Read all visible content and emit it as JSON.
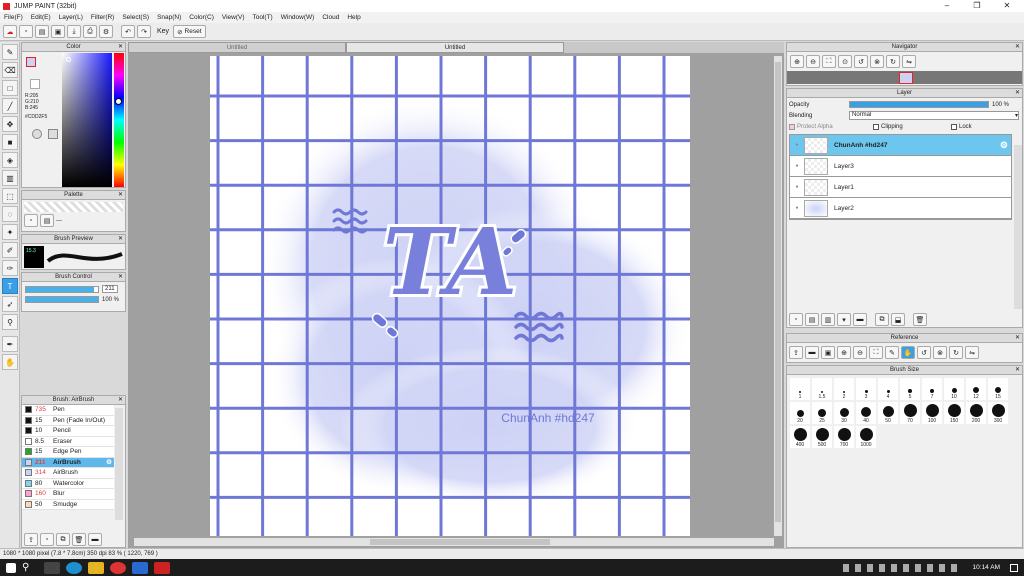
{
  "window": {
    "title": "JUMP PAINT (32bit)"
  },
  "menu": [
    "File(F)",
    "Edit(E)",
    "Layer(L)",
    "Filter(R)",
    "Select(S)",
    "Snap(N)",
    "Color(C)",
    "View(V)",
    "Tool(T)",
    "Window(W)",
    "Cloud",
    "Help"
  ],
  "toolbar": {
    "key_label": "Key",
    "reset_label": "Reset"
  },
  "color_panel": {
    "title": "Color",
    "r": "R:205",
    "g": "G:210",
    "b": "B:245",
    "hex": "#CDD2F5"
  },
  "palette_panel": {
    "title": "Palette",
    "dash": "---"
  },
  "brush_preview": {
    "title": "Brush Preview",
    "size": "15.3"
  },
  "brush_control": {
    "title": "Brush Control",
    "size": "211",
    "opacity": "100 %",
    "size_fill": 0.95,
    "opacity_fill": 1.0
  },
  "brush_list": {
    "title": "Brush: AirBrush",
    "items": [
      {
        "size": "735",
        "name": "Pen",
        "color": "#111111",
        "red": true
      },
      {
        "size": "15",
        "name": "Pen (Fade In/Out)",
        "color": "#111111",
        "red": false
      },
      {
        "size": "10",
        "name": "Pencil",
        "color": "#111111",
        "red": false
      },
      {
        "size": "8.5",
        "name": "Eraser",
        "color": "#ffffff",
        "red": false
      },
      {
        "size": "15",
        "name": "Edge Pen",
        "color": "#22aa22",
        "red": false
      },
      {
        "size": "211",
        "name": "AirBrush",
        "color": "#cdd2f5",
        "red": true,
        "selected": true
      },
      {
        "size": "314",
        "name": "AirBrush",
        "color": "#cdd2f5",
        "red": true
      },
      {
        "size": "80",
        "name": "Watercolor",
        "color": "#7fd6f0",
        "red": false
      },
      {
        "size": "160",
        "name": "Blur",
        "color": "#ff9fd0",
        "red": true
      },
      {
        "size": "50",
        "name": "Smudge",
        "color": "#ffd8b8",
        "red": false
      }
    ]
  },
  "tabs": [
    "Untitled",
    "Untitled"
  ],
  "canvas": {
    "watermark": "ChunAnh #hd247",
    "logo_text": "TA",
    "accent": "#6f78d6"
  },
  "navigator": {
    "title": "Navigator"
  },
  "layer_panel": {
    "title": "Layer",
    "opacity_label": "Opacity",
    "opacity_value": "100 %",
    "opacity_fill": 1.0,
    "blending_label": "Blending",
    "blending_value": "Normal",
    "protect_alpha": "Protect Alpha",
    "clipping": "Clipping",
    "lock": "Lock",
    "layers": [
      {
        "name": "ChunAnh #hd247",
        "selected": true
      },
      {
        "name": "Layer3"
      },
      {
        "name": "Layer1"
      },
      {
        "name": "Layer2"
      }
    ]
  },
  "reference": {
    "title": "Reference"
  },
  "brush_size": {
    "title": "Brush Size",
    "sizes": [
      "1",
      "1.5",
      "2",
      "3",
      "4",
      "5",
      "7",
      "10",
      "12",
      "15",
      "20",
      "25",
      "30",
      "40",
      "50",
      "70",
      "100",
      "150",
      "200",
      "300",
      "400",
      "500",
      "700",
      "1000"
    ]
  },
  "status": {
    "text": "1080 * 1080 pixel   (7.8 * 7.8cm)   350 dpi   83 %   ( 1220, 769 )"
  },
  "taskbar": {
    "time": "10:14 AM"
  }
}
